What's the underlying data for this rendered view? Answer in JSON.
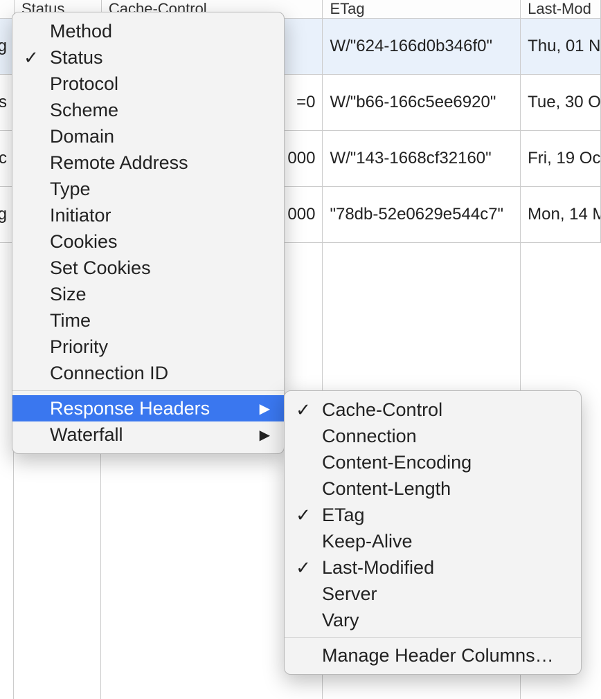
{
  "headers": {
    "name": "",
    "status": "Status",
    "cache": "Cache-Control",
    "etag": "ETag",
    "last": "Last-Mod"
  },
  "rows": [
    {
      "name": "g",
      "cache": "",
      "etag": "W/\"624-166d0b346f0\"",
      "last": "Thu, 01 N",
      "selected": true
    },
    {
      "name": ".js",
      "cache": "=0",
      "etag": "W/\"b66-166c5ee6920\"",
      "last": "Tue, 30 O",
      "selected": false
    },
    {
      "name": ".c",
      "cache": "000",
      "etag": "W/\"143-1668cf32160\"",
      "last": "Fri, 19 Oc",
      "selected": false
    },
    {
      "name": "g",
      "cache": "000",
      "etag": "\"78db-52e0629e544c7\"",
      "last": "Mon, 14 M",
      "selected": false
    }
  ],
  "menu1": {
    "items": [
      {
        "label": "Method",
        "checked": false,
        "submenu": false
      },
      {
        "label": "Status",
        "checked": true,
        "submenu": false
      },
      {
        "label": "Protocol",
        "checked": false,
        "submenu": false
      },
      {
        "label": "Scheme",
        "checked": false,
        "submenu": false
      },
      {
        "label": "Domain",
        "checked": false,
        "submenu": false
      },
      {
        "label": "Remote Address",
        "checked": false,
        "submenu": false
      },
      {
        "label": "Type",
        "checked": false,
        "submenu": false
      },
      {
        "label": "Initiator",
        "checked": false,
        "submenu": false
      },
      {
        "label": "Cookies",
        "checked": false,
        "submenu": false
      },
      {
        "label": "Set Cookies",
        "checked": false,
        "submenu": false
      },
      {
        "label": "Size",
        "checked": false,
        "submenu": false
      },
      {
        "label": "Time",
        "checked": false,
        "submenu": false
      },
      {
        "label": "Priority",
        "checked": false,
        "submenu": false
      },
      {
        "label": "Connection ID",
        "checked": false,
        "submenu": false
      }
    ],
    "sep_then": [
      {
        "label": "Response Headers",
        "checked": false,
        "submenu": true,
        "highlight": true
      },
      {
        "label": "Waterfall",
        "checked": false,
        "submenu": true,
        "highlight": false
      }
    ]
  },
  "menu2": {
    "items": [
      {
        "label": "Cache-Control",
        "checked": true
      },
      {
        "label": "Connection",
        "checked": false
      },
      {
        "label": "Content-Encoding",
        "checked": false
      },
      {
        "label": "Content-Length",
        "checked": false
      },
      {
        "label": "ETag",
        "checked": true
      },
      {
        "label": "Keep-Alive",
        "checked": false
      },
      {
        "label": "Last-Modified",
        "checked": true
      },
      {
        "label": "Server",
        "checked": false
      },
      {
        "label": "Vary",
        "checked": false
      }
    ],
    "footer": "Manage Header Columns…"
  }
}
